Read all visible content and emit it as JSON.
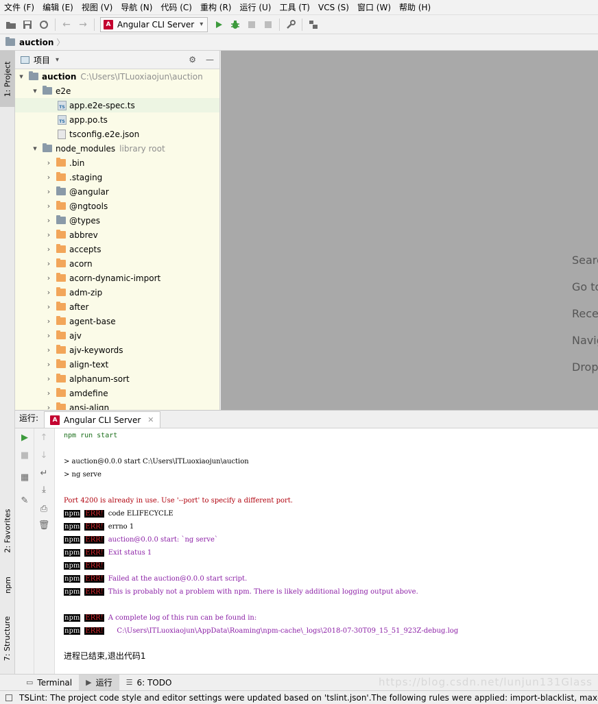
{
  "menu": [
    "文件 (F)",
    "编辑 (E)",
    "视图 (V)",
    "导航 (N)",
    "代码 (C)",
    "重构 (R)",
    "运行 (U)",
    "工具 (T)",
    "VCS (S)",
    "窗口 (W)",
    "帮助 (H)"
  ],
  "toolbar": {
    "run_config": "Angular CLI Server"
  },
  "breadcrumb": "auction",
  "left_tabs": {
    "project": "1: Project",
    "favorites": "2: Favorites",
    "npm": "npm",
    "structure": "7: Structure"
  },
  "project_panel": {
    "title": "项目",
    "root": {
      "name": "auction",
      "path": "C:\\Users\\ITLuoxiaojun\\auction"
    },
    "e2e": "e2e",
    "e2e_files": [
      "app.e2e-spec.ts",
      "app.po.ts",
      "tsconfig.e2e.json"
    ],
    "node_modules": {
      "name": "node_modules",
      "hint": "library root"
    },
    "modules": [
      ".bin",
      ".staging",
      "@angular",
      "@ngtools",
      "@types",
      "abbrev",
      "accepts",
      "acorn",
      "acorn-dynamic-import",
      "adm-zip",
      "after",
      "agent-base",
      "ajv",
      "ajv-keywords",
      "align-text",
      "alphanum-sort",
      "amdefine",
      "ansi-align"
    ]
  },
  "editor_hints": [
    "Searc",
    "Go to",
    "Recer",
    "Navig",
    "Drop"
  ],
  "run_panel": {
    "label": "运行:",
    "tab": "Angular CLI Server"
  },
  "console": {
    "cmd": "npm run start",
    "line1": "> auction@0.0.0 start C:\\Users\\ITLuoxiaojun\\auction",
    "line2": "> ng serve",
    "port_error": "Port 4200 is already in use. Use '--port' to specify a different port.",
    "npm": "npm",
    "err": "ERR!",
    "err_lines": [
      "code ELIFECYCLE",
      "errno 1",
      "auction@0.0.0 start: `ng serve`",
      "Exit status 1",
      "",
      "Failed at the auction@0.0.0 start script.",
      "This is probably not a problem with npm. There is likely additional logging output above."
    ],
    "log_lines": [
      "A complete log of this run can be found in:",
      "    C:\\Users\\ITLuoxiaojun\\AppData\\Roaming\\npm-cache\\_logs\\2018-07-30T09_15_51_923Z-debug.log"
    ],
    "exit": "进程已结束,退出代码1"
  },
  "bottom_tabs": [
    "Terminal",
    "运行",
    "6: TODO"
  ],
  "watermark": "https://blog.csdn.net/lunjun131Glass",
  "status": "TSLint: The project code style and editor settings were updated based on 'tslint.json'.The following rules were applied: import-blacklist, max-line-"
}
